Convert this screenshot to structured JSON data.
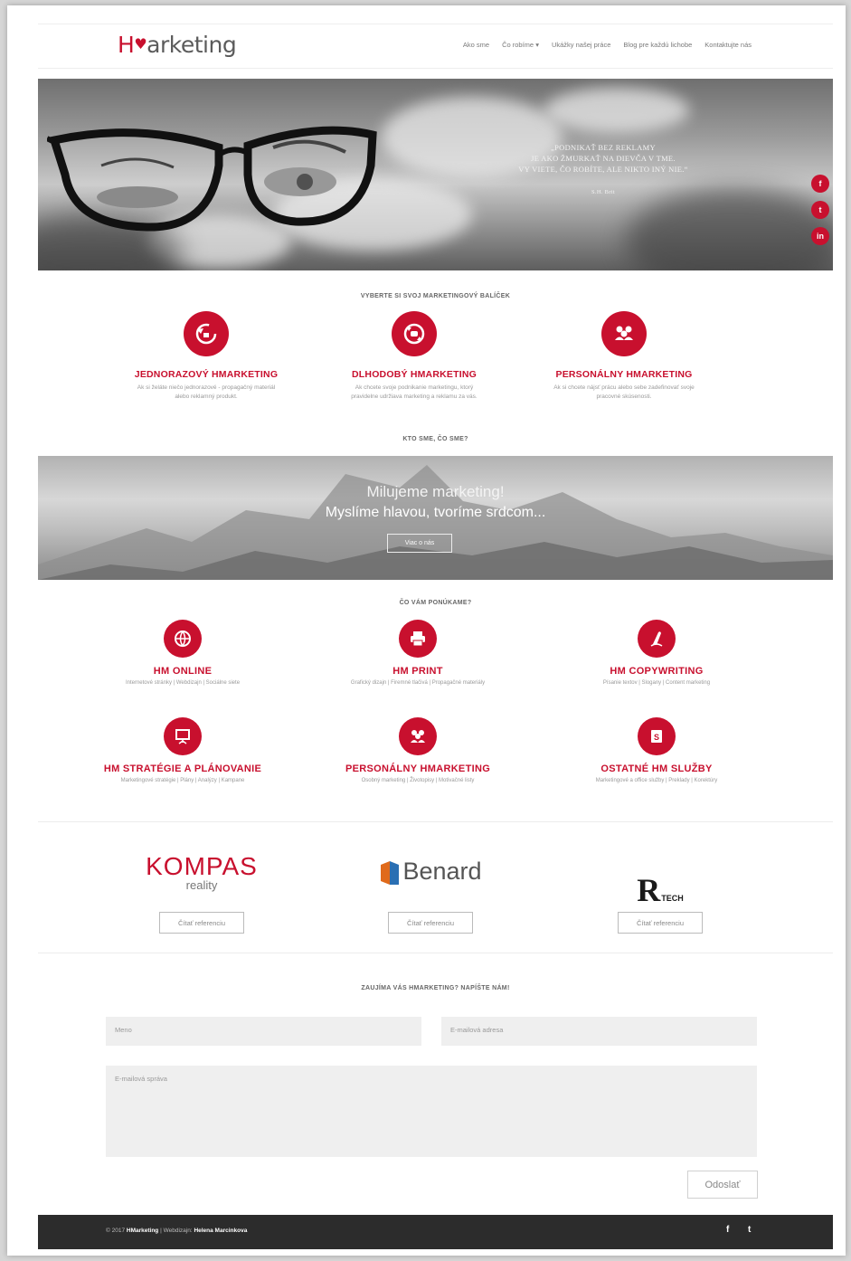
{
  "header": {
    "logo_h": "H",
    "logo_rest": "arketing",
    "nav": [
      "Ako sme",
      "Čo robíme",
      "Ukážky našej práce",
      "Blog pre každú lichobe",
      "Kontaktujte nás"
    ]
  },
  "hero": {
    "quote_lines": [
      "„Podnikať bez reklamy",
      "je ako žmurkať na dievča v tme.",
      "Vy viete, čo robíte, ale nikto iný nie.“"
    ],
    "author": "S.H. Brit",
    "social": [
      "f",
      "t",
      "in"
    ]
  },
  "packages": {
    "heading": "VYBERTE SI SVOJ MARKETINGOVÝ BALÍČEK",
    "items": [
      {
        "title": "JEDNORAZOVÝ HMARKETING",
        "desc": "Ak si želáte niečo jednorazové - propagačný materiál alebo reklamný produkt."
      },
      {
        "title": "DLHODOBÝ HMARKETING",
        "desc": "Ak chcete svoje podnikanie marketingu, ktorý pravidelne udržiava marketing a reklamu za vás."
      },
      {
        "title": "PERSONÁLNY HMARKETING",
        "desc": "Ak si chcete nájsť prácu alebo sebe zadefinovať svoje pracovné skúsenosti."
      }
    ]
  },
  "about": {
    "heading": "KTO SME, ČO SME?",
    "line1": "Milujeme marketing!",
    "line2": "Myslíme hlavou, tvoríme srdcom...",
    "button": "Viac o nás"
  },
  "services": {
    "heading": "ČO VÁM PONÚKAME?",
    "items": [
      {
        "title": "HM ONLINE",
        "desc": "Internetové stránky | Webdizajn | Sociálne siete"
      },
      {
        "title": "HM PRINT",
        "desc": "Grafický dizajn | Firemné tlačivá | Propagačné materiály"
      },
      {
        "title": "HM COPYWRITING",
        "desc": "Písanie textov | Slogany | Content marketing"
      },
      {
        "title": "HM STRATÉGIE A PLÁNOVANIE",
        "desc": "Marketingové stratégie | Plány | Analýzy | Kampane"
      },
      {
        "title": "PERSONÁLNY HMARKETING",
        "desc": "Osobný marketing | Životopisy | Motivačné listy"
      },
      {
        "title": "OSTATNÉ HM SLUŽBY",
        "desc": "Marketingové a office služby | Preklady | Korektúry"
      }
    ]
  },
  "clients": {
    "items": [
      {
        "name": "KOMPAS",
        "sub": "reality"
      },
      {
        "name": "Benard",
        "sub": ""
      },
      {
        "name": "R",
        "sub": "TECH"
      }
    ],
    "button": "Čítať referenciu"
  },
  "contact": {
    "heading": "ZAUJÍMA VÁS HMARKETING? NAPÍŠTE NÁM!",
    "name_placeholder": "Meno",
    "email_placeholder": "E-mailová adresa",
    "message_placeholder": "E-mailová správa",
    "submit": "Odoslať"
  },
  "footer": {
    "copyright": "© 2017 ",
    "brand": "HMarketing",
    "sep": " | Webdizajn: ",
    "designer": "Helena Marcinkova",
    "social": [
      "f",
      "t"
    ]
  },
  "colors": {
    "accent": "#c8102e",
    "footer": "#2c2c2c"
  }
}
